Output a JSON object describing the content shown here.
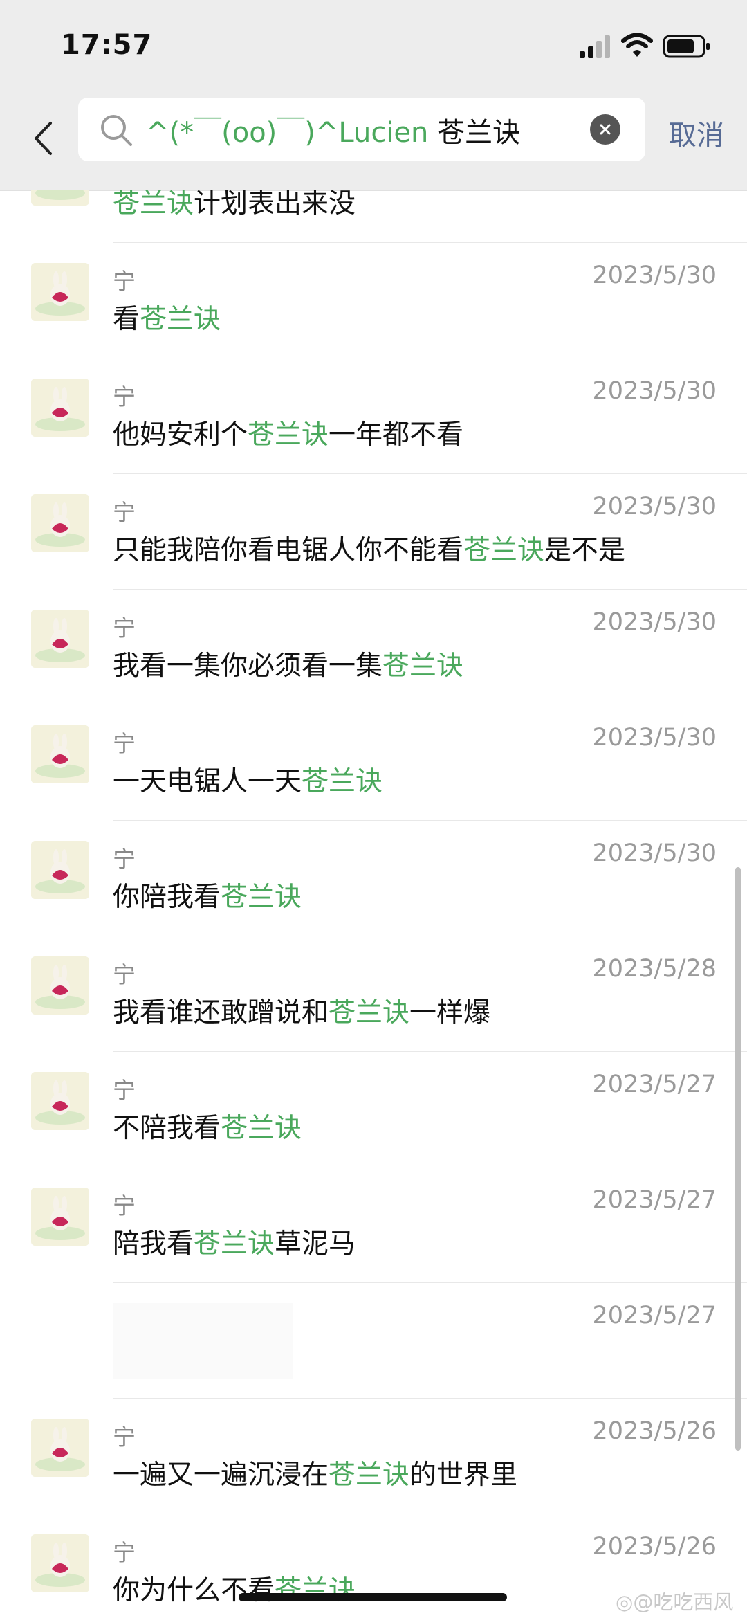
{
  "status_bar": {
    "time": "17:57"
  },
  "search": {
    "query_prefix": "^(*￣(oo)￣)^Lucien",
    "query_keyword": "苍兰诀",
    "cancel_label": "取消"
  },
  "results": [
    {
      "name": "",
      "date": "",
      "before": "",
      "highlight": "苍兰诀",
      "after": "计划表出来没"
    },
    {
      "name": "宁",
      "date": "2023/5/30",
      "before": "看",
      "highlight": "苍兰诀",
      "after": ""
    },
    {
      "name": "宁",
      "date": "2023/5/30",
      "before": "他妈安利个",
      "highlight": "苍兰诀",
      "after": "一年都不看"
    },
    {
      "name": "宁",
      "date": "2023/5/30",
      "before": "只能我陪你看电锯人你不能看",
      "highlight": "苍兰诀",
      "after": "是不是"
    },
    {
      "name": "宁",
      "date": "2023/5/30",
      "before": "我看一集你必须看一集",
      "highlight": "苍兰诀",
      "after": ""
    },
    {
      "name": "宁",
      "date": "2023/5/30",
      "before": "一天电锯人一天",
      "highlight": "苍兰诀",
      "after": ""
    },
    {
      "name": "宁",
      "date": "2023/5/30",
      "before": "你陪我看",
      "highlight": "苍兰诀",
      "after": ""
    },
    {
      "name": "宁",
      "date": "2023/5/28",
      "before": "我看谁还敢蹭说和",
      "highlight": "苍兰诀",
      "after": "一样爆"
    },
    {
      "name": "宁",
      "date": "2023/5/27",
      "before": "不陪我看",
      "highlight": "苍兰诀",
      "after": ""
    },
    {
      "name": "宁",
      "date": "2023/5/27",
      "before": "陪我看",
      "highlight": "苍兰诀",
      "after": "草泥马"
    },
    {
      "name": "",
      "date": "2023/5/27",
      "before": "",
      "highlight": "",
      "after": ""
    },
    {
      "name": "宁",
      "date": "2023/5/26",
      "before": "一遍又一遍沉浸在",
      "highlight": "苍兰诀",
      "after": "的世界里"
    },
    {
      "name": "宁",
      "date": "2023/5/26",
      "before": "你为什么不看",
      "highlight": "苍兰诀",
      "after": ""
    }
  ],
  "watermark": "@吃吃西风",
  "colors": {
    "highlight": "#4aa85c",
    "cancel": "#576b95",
    "header_bg": "#ededed"
  },
  "icons": [
    "signal-icon",
    "wifi-icon",
    "battery-icon",
    "back-chevron-icon",
    "search-icon",
    "clear-icon",
    "bunny-avatar",
    "weibo-icon"
  ]
}
